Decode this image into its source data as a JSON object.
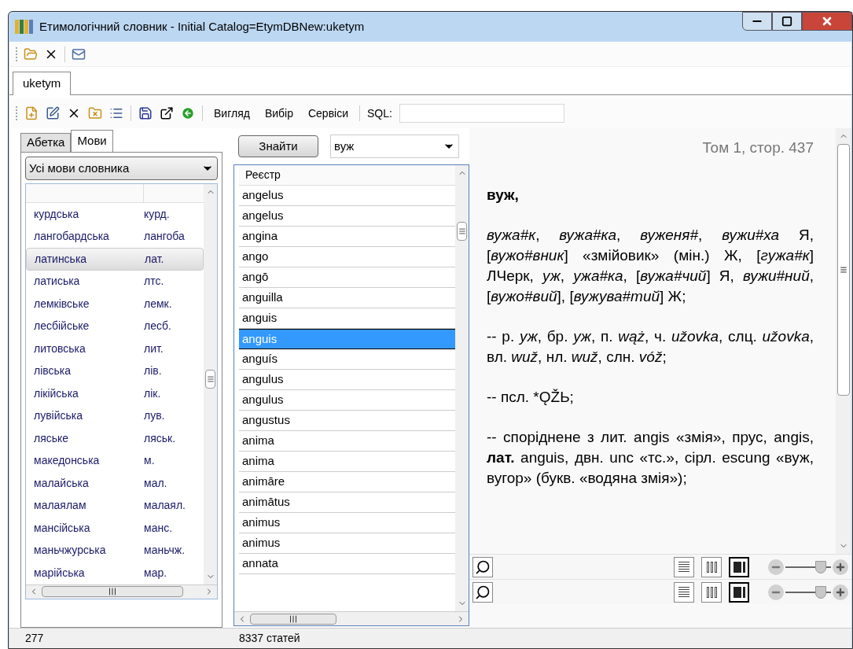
{
  "window": {
    "title": "Етимологічний словник - Initial Catalog=EtymDBNew:uketym"
  },
  "tabs": [
    {
      "label": "uketym",
      "selected": true
    }
  ],
  "menu": [
    {
      "label": "Вигляд"
    },
    {
      "label": "Вибір"
    },
    {
      "label": "Сервіси"
    }
  ],
  "sql_label": "SQL:",
  "left_tabs": [
    {
      "label": "Абетка",
      "selected": false
    },
    {
      "label": "Мови",
      "selected": true
    }
  ],
  "language_filter": {
    "value": "Усі мови словника"
  },
  "languages": [
    {
      "name": "курдська",
      "abbr": "курд.",
      "selected": false
    },
    {
      "name": "лангобардська",
      "abbr": "лангоба",
      "selected": false
    },
    {
      "name": "латинська",
      "abbr": "лат.",
      "selected": true
    },
    {
      "name": "латиська",
      "abbr": "лтс.",
      "selected": false
    },
    {
      "name": "лемківське",
      "abbr": "лемк.",
      "selected": false
    },
    {
      "name": "лесбійське",
      "abbr": "лесб.",
      "selected": false
    },
    {
      "name": "литовська",
      "abbr": "лит.",
      "selected": false
    },
    {
      "name": "лівська",
      "abbr": "лів.",
      "selected": false
    },
    {
      "name": "лікійська",
      "abbr": "лік.",
      "selected": false
    },
    {
      "name": "лувійська",
      "abbr": "лув.",
      "selected": false
    },
    {
      "name": "ляське",
      "abbr": "ляськ.",
      "selected": false
    },
    {
      "name": "македонська",
      "abbr": "м.",
      "selected": false
    },
    {
      "name": "малайська",
      "abbr": "мал.",
      "selected": false
    },
    {
      "name": "малаялам",
      "abbr": "малаял.",
      "selected": false
    },
    {
      "name": "мансійська",
      "abbr": "манс.",
      "selected": false
    },
    {
      "name": "маньчжурська",
      "abbr": "маньчж.",
      "selected": false
    },
    {
      "name": "марійська",
      "abbr": "мар.",
      "selected": false
    }
  ],
  "search": {
    "button": "Знайти",
    "value": "вуж"
  },
  "register": {
    "column": "Реєстр",
    "rows": [
      {
        "word": "angelus",
        "selected": false
      },
      {
        "word": "angelus",
        "selected": false
      },
      {
        "word": "angina",
        "selected": false
      },
      {
        "word": "ango",
        "selected": false
      },
      {
        "word": "angō",
        "selected": false
      },
      {
        "word": "anguilla",
        "selected": false
      },
      {
        "word": "anguis",
        "selected": false
      },
      {
        "word": "anguis",
        "selected": true
      },
      {
        "word": "anguís",
        "selected": false
      },
      {
        "word": "angulus",
        "selected": false
      },
      {
        "word": "angulus",
        "selected": false
      },
      {
        "word": "angustus",
        "selected": false
      },
      {
        "word": "anima",
        "selected": false
      },
      {
        "word": "anima",
        "selected": false
      },
      {
        "word": "animāre",
        "selected": false
      },
      {
        "word": "animātus",
        "selected": false
      },
      {
        "word": "animus",
        "selected": false
      },
      {
        "word": "animus",
        "selected": false
      },
      {
        "word": "annata",
        "selected": false
      }
    ]
  },
  "article": {
    "page_ref": "Том 1, стор. 437",
    "paragraphs": [
      {
        "kind": "headword",
        "text": "вуж,"
      },
      {
        "kind": "body",
        "text": "*вужа#к*, *вужа#ка*, *вуженя#*, *вужи#ха* Я, [*вужо#вник*] «змійовик» (мін.) Ж, [*гужа#к*] ЛЧерк, *уж*, *ужа#ка*, [*вужа#чий*] Я, *вужи#ний*, [*вужо#вий*], [*вужува#тий*] Ж;"
      },
      {
        "kind": "body",
        "text": "-- р. *уж*, бр. *уж*, п. *wąż*, ч. *užovka*, слц. *užovka*, вл. *wuž*, нл. *wuž*, слн. *vóž*;"
      },
      {
        "kind": "plain",
        "text": "-- псл. *ǪŽЬ;"
      },
      {
        "kind": "body",
        "text": "-- споріднене з лит. angis «змія», прус, angis, **лат.** anguis, двн. unc «тс.», сірл. escung «вуж, вугор» (букв. «водяна змія»);"
      }
    ]
  },
  "viewers": [
    {
      "views": [
        {
          "kind": "single",
          "selected": false
        },
        {
          "kind": "double",
          "selected": false
        },
        {
          "kind": "sidebar",
          "selected": true
        }
      ],
      "zoom": {
        "level": 0.78
      }
    },
    {
      "views": [
        {
          "kind": "single",
          "selected": false
        },
        {
          "kind": "double",
          "selected": false
        },
        {
          "kind": "sidebar",
          "selected": true
        }
      ],
      "zoom": {
        "level": 0.78
      }
    }
  ],
  "status_bar": [
    "277",
    "8337 статей"
  ]
}
